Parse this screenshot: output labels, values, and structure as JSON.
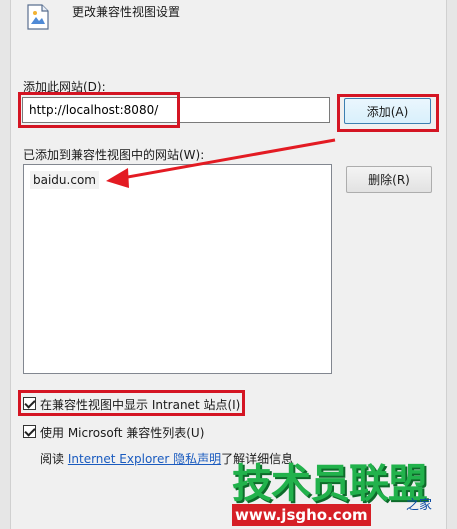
{
  "dialog": {
    "title": "更改兼容性视图设置",
    "icon": "compatibility-view-icon"
  },
  "add_site": {
    "label": "添加此网站(D):",
    "input_value": "http://localhost:8080/",
    "add_button": "添加(A)"
  },
  "added_sites": {
    "label": "已添加到兼容性视图中的网站(W):",
    "items": [
      "baidu.com"
    ],
    "remove_button": "删除(R)"
  },
  "options": {
    "show_intranet": {
      "label": "在兼容性视图中显示 Intranet 站点(I)",
      "checked": true
    },
    "use_ms_list": {
      "label": "使用 Microsoft 兼容性列表(U)",
      "checked": true
    }
  },
  "footer": {
    "read_prefix": "阅读",
    "link_text": "Internet Explorer 隐私声明",
    "suffix": "了解详细信息"
  },
  "watermark": {
    "main": "技术员联盟",
    "sub": "www.jsgho.com",
    "tail": "之家"
  },
  "colors": {
    "highlight_red": "#d41523",
    "link_blue": "#1a5bbf",
    "watermark_green": "#22b24c"
  }
}
